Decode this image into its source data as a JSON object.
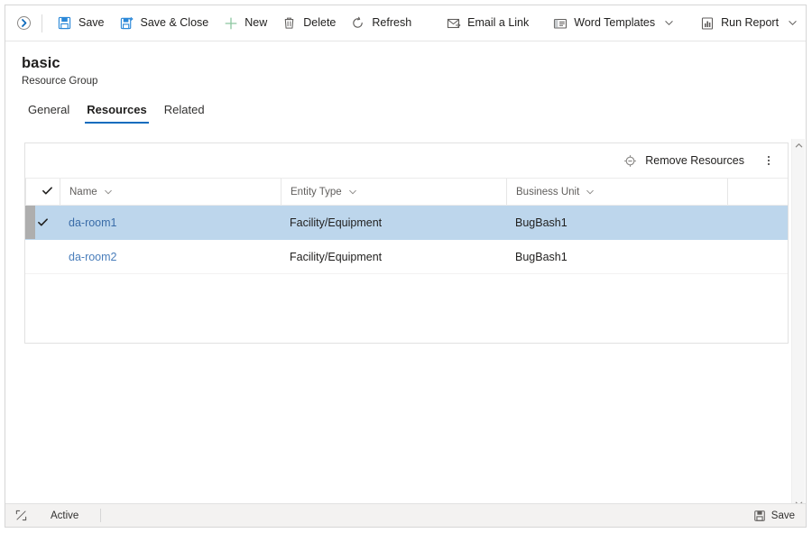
{
  "commandbar": {
    "expand_icon": "expand-circle-chevron-icon",
    "buttons": [
      {
        "label": "Save",
        "icon": "save-floppy-icon",
        "caret": false
      },
      {
        "label": "Save & Close",
        "icon": "save-and-close-icon",
        "caret": false
      },
      {
        "label": "New",
        "icon": "plus-icon",
        "caret": false
      },
      {
        "label": "Delete",
        "icon": "trash-icon",
        "caret": false
      },
      {
        "label": "Refresh",
        "icon": "refresh-icon",
        "caret": false
      },
      {
        "label": "Email a Link",
        "icon": "email-link-icon",
        "caret": false
      },
      {
        "label": "Word Templates",
        "icon": "word-template-icon",
        "caret": true
      },
      {
        "label": "Run Report",
        "icon": "report-chart-icon",
        "caret": true
      }
    ]
  },
  "record": {
    "title": "basic",
    "subtitle": "Resource Group"
  },
  "tabs": [
    {
      "label": "General",
      "active": false
    },
    {
      "label": "Resources",
      "active": true
    },
    {
      "label": "Related",
      "active": false
    }
  ],
  "grid_commandbar": {
    "remove_label": "Remove Resources",
    "remove_icon": "remove-link-icon",
    "overflow_icon": "more-vertical-icon"
  },
  "grid": {
    "columns": [
      {
        "label": "Name",
        "caret": true
      },
      {
        "label": "Entity Type",
        "caret": true
      },
      {
        "label": "Business Unit",
        "caret": true
      }
    ],
    "rows": [
      {
        "selected": true,
        "name": "da-room1",
        "entity_type": "Facility/Equipment",
        "business_unit": "BugBash1"
      },
      {
        "selected": false,
        "name": "da-room2",
        "entity_type": "Facility/Equipment",
        "business_unit": "BugBash1"
      }
    ]
  },
  "footer": {
    "resize_icon": "resize-expand-icon",
    "status": "Active",
    "save_label": "Save",
    "save_icon": "save-floppy-icon"
  },
  "colors": {
    "accent": "#0f6cbd",
    "selection": "#bdd6ec",
    "link": "#4a7ebb",
    "new_icon": "#8cc6a0"
  }
}
